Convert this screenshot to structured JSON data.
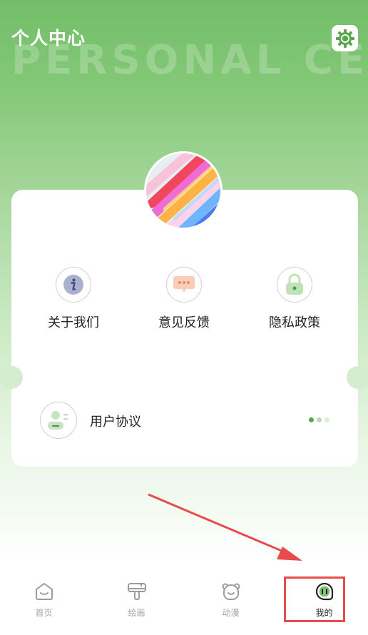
{
  "header": {
    "title": "个人中心",
    "watermark": "PERSONAL CENTER",
    "settings_icon": "gear-icon"
  },
  "menu": [
    {
      "label": "关于我们",
      "icon": "info-icon"
    },
    {
      "label": "意见反馈",
      "icon": "chat-bubble-icon"
    },
    {
      "label": "隐私政策",
      "icon": "lock-icon"
    }
  ],
  "agreement": {
    "label": "用户协议",
    "icon": "user-profile-icon"
  },
  "tabs": [
    {
      "label": "首页",
      "icon": "home-icon",
      "active": false
    },
    {
      "label": "绘画",
      "icon": "paint-roller-icon",
      "active": false
    },
    {
      "label": "动漫",
      "icon": "bear-face-icon",
      "active": false
    },
    {
      "label": "我的",
      "icon": "profile-face-icon",
      "active": true
    }
  ],
  "colors": {
    "header_green": "#73bd68",
    "accent_green": "#5aa64d",
    "highlight_red": "#e84b4b"
  }
}
